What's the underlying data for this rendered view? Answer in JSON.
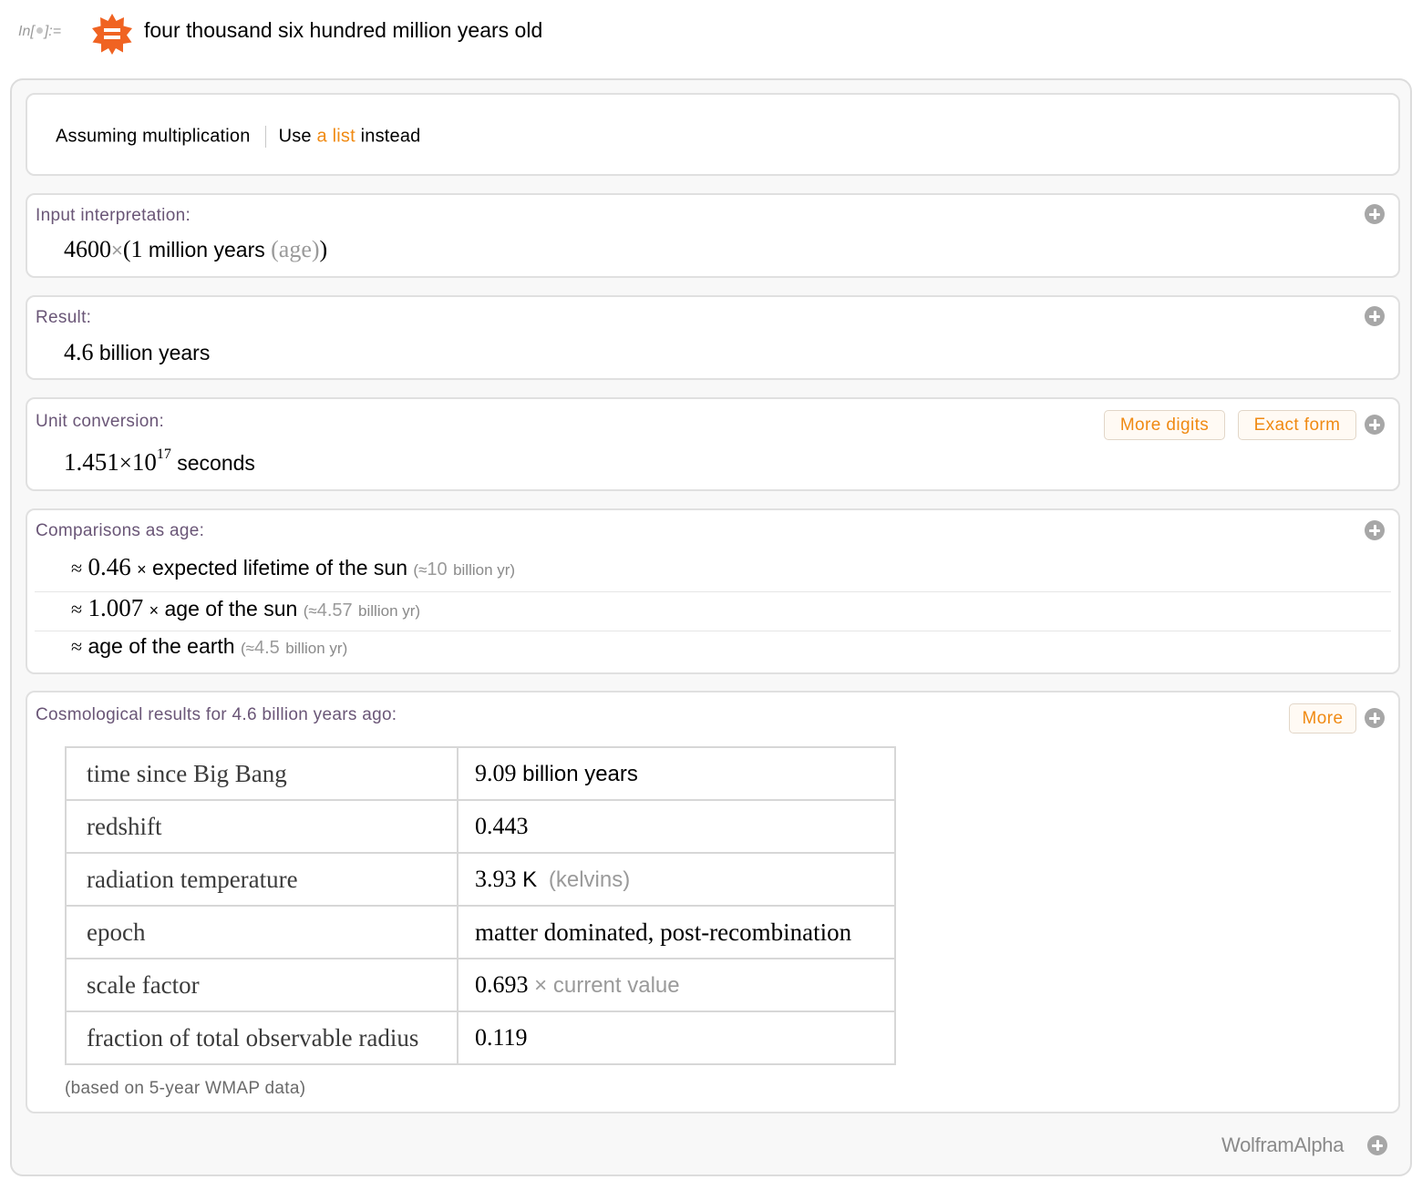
{
  "input_cell": {
    "label_prefix": "In[",
    "label_suffix": "]:=",
    "query": "four thousand six hundred million years old"
  },
  "assumption": {
    "assuming_text": "Assuming multiplication",
    "use_text": "Use",
    "link_text": "a list",
    "instead_text": "instead"
  },
  "input_interpretation": {
    "title": "Input interpretation:",
    "number": "4600",
    "times": "×",
    "open_paren": "(",
    "one": "1",
    "unit": "million years",
    "qualifier": "(age)",
    "close_paren": ")"
  },
  "result": {
    "title": "Result:",
    "number": "4.6",
    "unit": "billion years"
  },
  "unit_conversion": {
    "title": "Unit conversion:",
    "mantissa": "1.451",
    "times": "×",
    "base": "10",
    "exponent": "17",
    "unit": "seconds",
    "more_digits_label": "More digits",
    "exact_form_label": "Exact form"
  },
  "comparisons": {
    "title": "Comparisons as age:",
    "rows": [
      {
        "approx": "≈",
        "factor": "0.46",
        "times": "×",
        "text": "expected lifetime of the sun",
        "paren_open": "(",
        "approx_small": "≈",
        "value": "10",
        "unit": "billion yr",
        "paren_close": ")"
      },
      {
        "approx": "≈",
        "factor": "1.007",
        "times": "×",
        "text": "age of the sun",
        "paren_open": "(",
        "approx_small": "≈",
        "value": "4.57",
        "unit": "billion yr",
        "paren_close": ")"
      },
      {
        "approx": "≈",
        "factor": "",
        "times": "",
        "text": "age of the earth",
        "paren_open": "(",
        "approx_small": "≈",
        "value": "4.5",
        "unit": "billion yr",
        "paren_close": ")"
      }
    ]
  },
  "cosmological": {
    "title": "Cosmological results for 4.6 billion years ago:",
    "more_label": "More",
    "rows": [
      {
        "label": "time since Big Bang",
        "num": "9.09",
        "unit": "billion years",
        "extra": ""
      },
      {
        "label": "redshift",
        "num": "0.443",
        "unit": "",
        "extra": ""
      },
      {
        "label": "radiation temperature",
        "num": "3.93",
        "unit": "K",
        "extra": "(kelvins)"
      },
      {
        "label": "epoch",
        "num": "matter dominated, post-recombination",
        "unit": "",
        "extra": ""
      },
      {
        "label": "scale factor",
        "num": "0.693",
        "unit": "",
        "extra": "× current value"
      },
      {
        "label": "fraction of total observable radius",
        "num": "0.119",
        "unit": "",
        "extra": ""
      }
    ],
    "note": "(based on 5-year WMAP data)"
  },
  "footer": {
    "brand": "WolframAlpha"
  },
  "colors": {
    "accent": "#f08a13",
    "pod_title": "#6a5677",
    "border": "#e0e0e0"
  }
}
